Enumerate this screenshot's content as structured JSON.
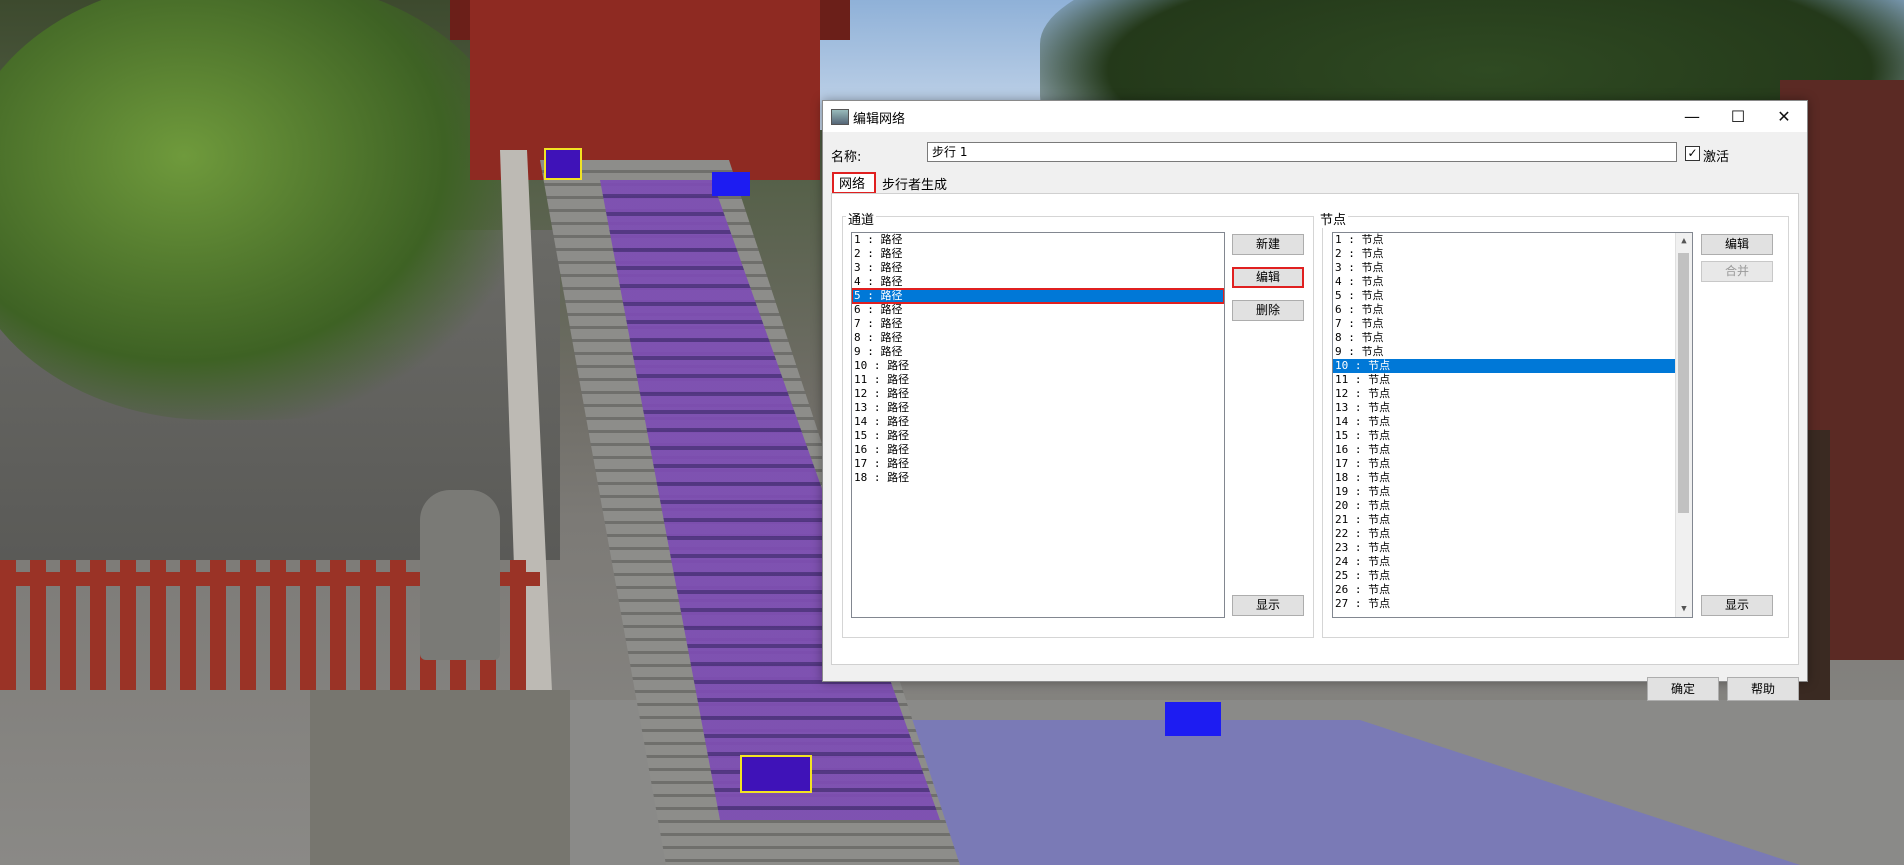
{
  "window": {
    "title": "编辑网络"
  },
  "form": {
    "name_label": "名称:",
    "name_value": "步行 1",
    "activate_label": "激活",
    "activate_checked": true
  },
  "tabs": [
    {
      "label": "网络",
      "active": true
    },
    {
      "label": "步行者生成",
      "active": false
    }
  ],
  "channels": {
    "label": "通道",
    "items": [
      "1 : 路径",
      "2 : 路径",
      "3 : 路径",
      "4 : 路径",
      "5 : 路径",
      "6 : 路径",
      "7 : 路径",
      "8 : 路径",
      "9 : 路径",
      "10 : 路径",
      "11 : 路径",
      "12 : 路径",
      "13 : 路径",
      "14 : 路径",
      "15 : 路径",
      "16 : 路径",
      "17 : 路径",
      "18 : 路径"
    ],
    "selected_index": 4,
    "buttons": {
      "new": "新建",
      "edit": "编辑",
      "delete": "删除",
      "show": "显示"
    }
  },
  "nodes": {
    "label": "节点",
    "items": [
      "1 : 节点",
      "2 : 节点",
      "3 : 节点",
      "4 : 节点",
      "5 : 节点",
      "6 : 节点",
      "7 : 节点",
      "8 : 节点",
      "9 : 节点",
      "10 : 节点",
      "11 : 节点",
      "12 : 节点",
      "13 : 节点",
      "14 : 节点",
      "15 : 节点",
      "16 : 节点",
      "17 : 节点",
      "18 : 节点",
      "19 : 节点",
      "20 : 节点",
      "21 : 节点",
      "22 : 节点",
      "23 : 节点",
      "24 : 节点",
      "25 : 节点",
      "26 : 节点",
      "27 : 节点"
    ],
    "selected_index": 9,
    "buttons": {
      "edit": "编辑",
      "merge": "合并",
      "show": "显示"
    }
  },
  "footer": {
    "ok": "确定",
    "help": "帮助"
  },
  "colors": {
    "selection": "#0078d7",
    "highlight_border": "#e02020"
  }
}
